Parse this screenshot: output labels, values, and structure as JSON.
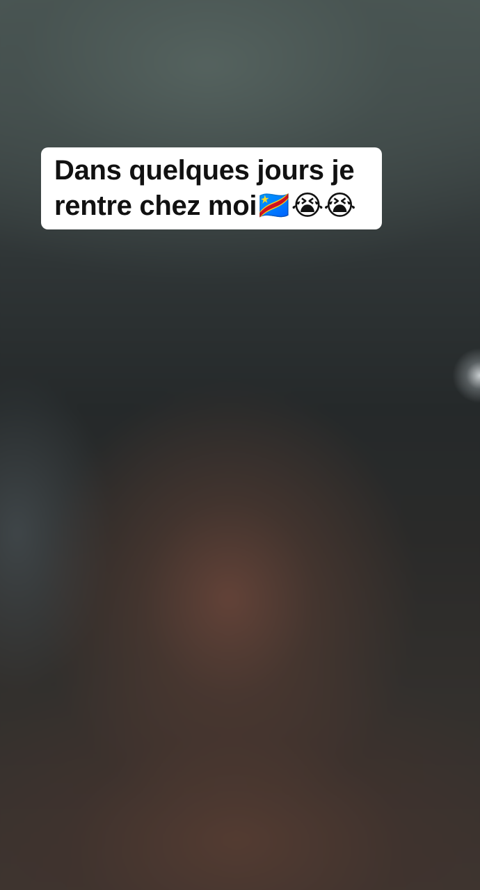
{
  "caption": {
    "text": "Dans quelques jours je\nrentre chez moi🇨🇩😭😭"
  },
  "colors": {
    "caption_background": "#ffffff",
    "caption_text": "#111111"
  }
}
